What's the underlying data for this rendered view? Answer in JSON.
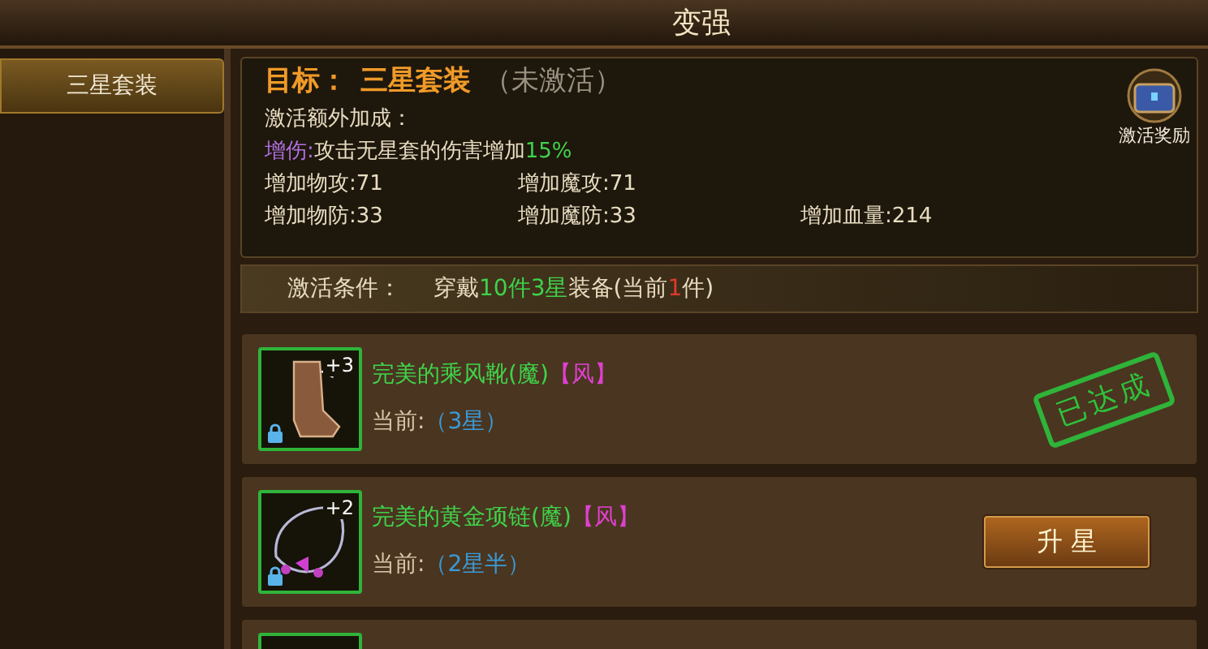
{
  "window": {
    "title": "变强"
  },
  "sidebar": {
    "items": [
      {
        "label": "三星套装",
        "selected": true
      }
    ]
  },
  "target": {
    "label": "目标：",
    "name": "三星套装",
    "status": "（未激活）"
  },
  "bonus": {
    "heading": "激活额外加成：",
    "tag": "增伤",
    "separator": ":",
    "text": "攻击无星套的伤害增加",
    "value": "15%"
  },
  "stats": [
    [
      {
        "label": "增加物攻:",
        "value": "71"
      },
      {
        "label": "增加魔攻:",
        "value": "71"
      }
    ],
    [
      {
        "label": "增加物防:",
        "value": "33"
      },
      {
        "label": "增加魔防:",
        "value": "33"
      },
      {
        "label": "增加血量:",
        "value": "214"
      }
    ]
  ],
  "reward": {
    "label": "激活奖励"
  },
  "condition": {
    "label": "激活条件：",
    "parts": [
      {
        "kind": "plain",
        "text": "穿戴"
      },
      {
        "kind": "good",
        "text": "10件"
      },
      {
        "kind": "good",
        "text": "3星"
      },
      {
        "kind": "plain",
        "text": "装备(当前"
      },
      {
        "kind": "bad",
        "text": "1"
      },
      {
        "kind": "plain",
        "text": "件)"
      }
    ]
  },
  "items": [
    {
      "kind": "boots",
      "name": "完美的乘风靴(魔)",
      "element": "【风】",
      "plus": "+3",
      "locked": true,
      "current_label": "当前:",
      "current": "（3星）",
      "status": {
        "kind": "achieved",
        "text": "已达成"
      }
    },
    {
      "kind": "necklace",
      "name": "完美的黄金项链(魔)",
      "element": "【风】",
      "plus": "+2",
      "locked": true,
      "current_label": "当前:",
      "current": "（2星半）",
      "status": {
        "kind": "button",
        "text": "升 星"
      }
    }
  ]
}
